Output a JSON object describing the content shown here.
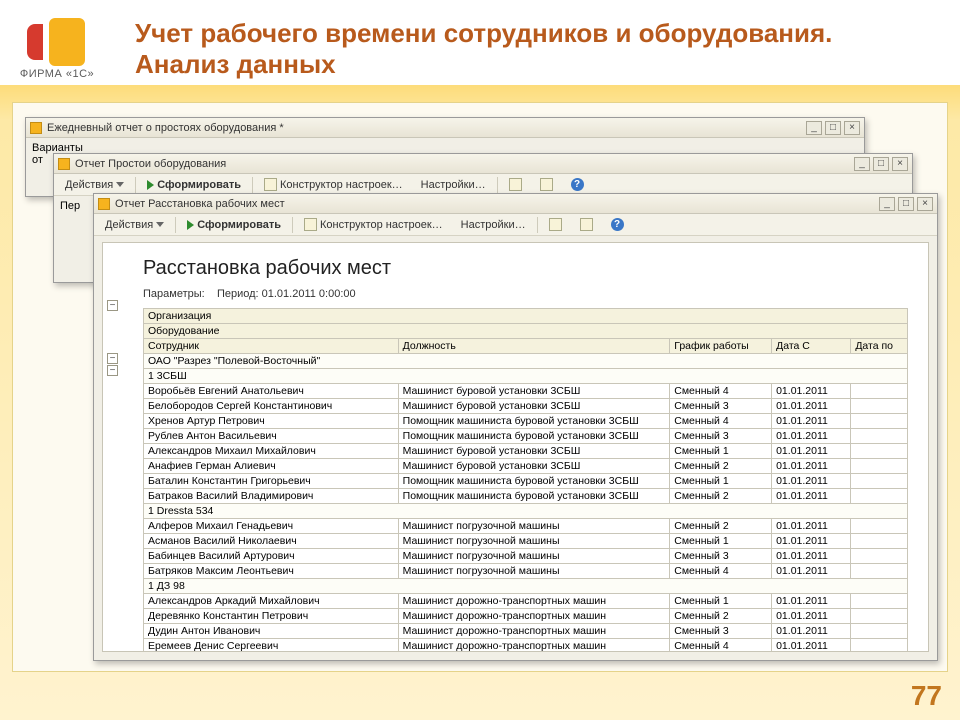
{
  "slide": {
    "title": "Учет рабочего времени сотрудников и оборудования. Анализ данных",
    "page_number": "77",
    "brand_label": "ФИРМА «1С»"
  },
  "win1": {
    "title": "Ежедневный отчет о простоях оборудования *",
    "body_line": "Варианты",
    "body_line2": "от"
  },
  "win2": {
    "title": "Отчет  Простои оборудования",
    "body_line": "Пер"
  },
  "toolbar": {
    "actions": "Действия",
    "generate": "Сформировать",
    "constructor": "Конструктор настроек…",
    "settings": "Настройки…"
  },
  "win3": {
    "title": "Отчет  Расстановка рабочих мест"
  },
  "report": {
    "title": "Расстановка рабочих мест",
    "params_label": "Параметры:",
    "period_label": "Период:",
    "period_value": "01.01.2011 0:00:00",
    "hdr_org": "Организация",
    "hdr_equip": "Оборудование",
    "col_emp": "Сотрудник",
    "col_pos": "Должность",
    "col_sched": "График работы",
    "col_dfrom": "Дата С",
    "col_dto": "Дата по",
    "org_row": "ОАО \"Разрез \"Полевой-Восточный\"",
    "groups": [
      {
        "name": "1 3СБШ",
        "rows": [
          {
            "emp": "Воробьёв Евгений Анатольевич",
            "pos": "Машинист буровой установки 3СБШ",
            "sched": "Сменный 4",
            "df": "01.01.2011"
          },
          {
            "emp": "Белобородов Сергей Константинович",
            "pos": "Машинист буровой установки 3СБШ",
            "sched": "Сменный 3",
            "df": "01.01.2011"
          },
          {
            "emp": "Хренов Артур Петрович",
            "pos": "Помощник машиниста буровой установки 3СБШ",
            "sched": "Сменный 4",
            "df": "01.01.2011"
          },
          {
            "emp": "Рублев Антон Васильевич",
            "pos": "Помощник машиниста буровой установки 3СБШ",
            "sched": "Сменный 3",
            "df": "01.01.2011"
          },
          {
            "emp": "Александров Михаил Михайлович",
            "pos": "Машинист буровой установки 3СБШ",
            "sched": "Сменный 1",
            "df": "01.01.2011"
          },
          {
            "emp": "Анафиев Герман Алиевич",
            "pos": "Машинист буровой установки 3СБШ",
            "sched": "Сменный 2",
            "df": "01.01.2011"
          },
          {
            "emp": "Баталин Константин Григорьевич",
            "pos": "Помощник машиниста буровой установки 3СБШ",
            "sched": "Сменный 1",
            "df": "01.01.2011"
          },
          {
            "emp": "Батраков Василий Владимирович",
            "pos": "Помощник машиниста буровой установки 3СБШ",
            "sched": "Сменный 2",
            "df": "01.01.2011"
          }
        ]
      },
      {
        "name": "1 Dressta 534",
        "rows": [
          {
            "emp": "Алферов Михаил Генадьевич",
            "pos": "Машинист погрузочной машины",
            "sched": "Сменный 2",
            "df": "01.01.2011"
          },
          {
            "emp": "Асманов Василий Николаевич",
            "pos": "Машинист погрузочной машины",
            "sched": "Сменный 1",
            "df": "01.01.2011"
          },
          {
            "emp": "Бабинцев Василий Артурович",
            "pos": "Машинист погрузочной машины",
            "sched": "Сменный 3",
            "df": "01.01.2011"
          },
          {
            "emp": "Батряков Максим Леонтьевич",
            "pos": "Машинист погрузочной машины",
            "sched": "Сменный 4",
            "df": "01.01.2011"
          }
        ]
      },
      {
        "name": "1 ДЗ 98",
        "rows": [
          {
            "emp": "Александров Аркадий Михайлович",
            "pos": "Машинист дорожно-транспортных машин",
            "sched": "Сменный 1",
            "df": "01.01.2011"
          },
          {
            "emp": "Деревянко Константин Петрович",
            "pos": "Машинист дорожно-транспортных машин",
            "sched": "Сменный 2",
            "df": "01.01.2011"
          },
          {
            "emp": "Дудин Антон Иванович",
            "pos": "Машинист дорожно-транспортных машин",
            "sched": "Сменный 3",
            "df": "01.01.2011"
          },
          {
            "emp": "Еремеев Денис Сергеевич",
            "pos": "Машинист дорожно-транспортных машин",
            "sched": "Сменный 4",
            "df": "01.01.2011"
          }
        ]
      }
    ]
  },
  "winctl": {
    "min": "_",
    "max": "□",
    "close": "×"
  }
}
